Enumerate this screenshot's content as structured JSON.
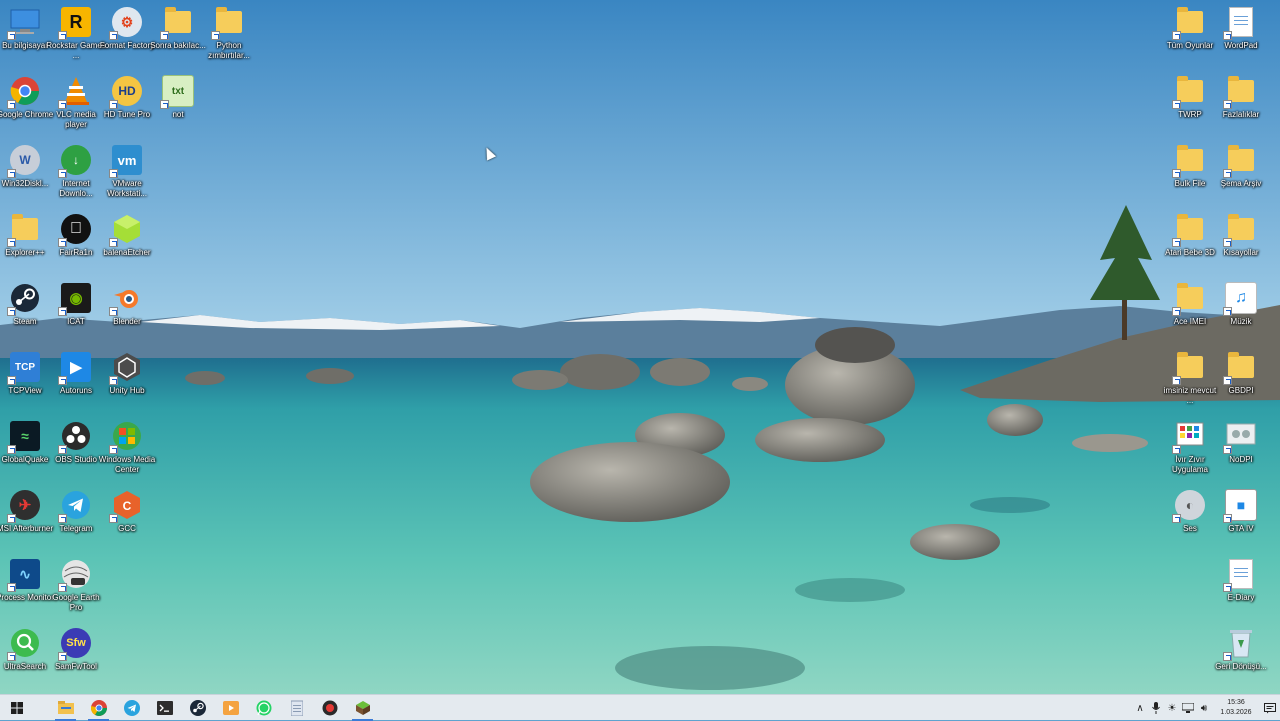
{
  "desktop": {
    "left_icons": [
      {
        "label": "Bu bilgisayar",
        "icon": "this-pc-icon"
      },
      {
        "label": "Rockstar Games ...",
        "icon": "rockstar-icon"
      },
      {
        "label": "Format Factory",
        "icon": "format-factory-icon"
      },
      {
        "label": "Sonra bakılac...",
        "icon": "folder-icon"
      },
      {
        "label": "Python zımbırtılar...",
        "icon": "folder-icon"
      },
      {
        "label": "Google Chrome",
        "icon": "chrome-icon"
      },
      {
        "label": "VLC media player",
        "icon": "vlc-icon"
      },
      {
        "label": "HD Tune Pro",
        "icon": "hdtune-icon"
      },
      {
        "label": "not",
        "icon": "notepad-icon"
      },
      {
        "label": "Win32Diskl...",
        "icon": "win32disk-icon"
      },
      {
        "label": "Internet Downlo...",
        "icon": "idm-icon"
      },
      {
        "label": "VMware Workstati...",
        "icon": "vmware-icon"
      },
      {
        "label": "Explorer++",
        "icon": "folder-icon"
      },
      {
        "label": "FairRa1n",
        "icon": "apple-icon"
      },
      {
        "label": "balenaEtcher",
        "icon": "etcher-icon"
      },
      {
        "label": "Steam",
        "icon": "steam-icon"
      },
      {
        "label": "ICAT",
        "icon": "nvidia-icon"
      },
      {
        "label": "Blender",
        "icon": "blender-icon"
      },
      {
        "label": "TCPView",
        "icon": "tcpview-icon"
      },
      {
        "label": "Autoruns",
        "icon": "autoruns-icon"
      },
      {
        "label": "Unity Hub",
        "icon": "unity-icon"
      },
      {
        "label": "GlobalQuake",
        "icon": "globalquake-icon"
      },
      {
        "label": "OBS Studio",
        "icon": "obs-icon"
      },
      {
        "label": "Windows Media Center",
        "icon": "wmc-icon"
      },
      {
        "label": "MSI Afterburner",
        "icon": "afterburner-icon"
      },
      {
        "label": "Telegram",
        "icon": "telegram-icon"
      },
      {
        "label": "GCC",
        "icon": "gcc-icon"
      },
      {
        "label": "Process Monitor",
        "icon": "procmon-icon"
      },
      {
        "label": "Google Earth Pro",
        "icon": "earth-icon"
      },
      {
        "label": "UltraSearch",
        "icon": "ultrasearch-icon"
      },
      {
        "label": "SamFwTool",
        "icon": "samfw-icon"
      }
    ],
    "right_icons": [
      {
        "label": "Tüm Oyunlar",
        "icon": "folder-icon"
      },
      {
        "label": "WordPad",
        "icon": "wordpad-icon"
      },
      {
        "label": "TWRP",
        "icon": "folder-icon"
      },
      {
        "label": "Fazlalıklar",
        "icon": "folder-icon"
      },
      {
        "label": "Bulk File",
        "icon": "folder-icon"
      },
      {
        "label": "Şema Arşiv",
        "icon": "folder-icon"
      },
      {
        "label": "Atari Bebe 3D",
        "icon": "folder-icon"
      },
      {
        "label": "Kısayollar",
        "icon": "folder-icon"
      },
      {
        "label": "Ace IMEI",
        "icon": "folder-icon"
      },
      {
        "label": "Müzik",
        "icon": "music-icon"
      },
      {
        "label": "imsiniz mevcut ...",
        "icon": "folder-icon"
      },
      {
        "label": "GBDPI",
        "icon": "folder-icon"
      },
      {
        "label": "İvır Zıvır Uygulama",
        "icon": "apps-grid-icon"
      },
      {
        "label": "NoDPI",
        "icon": "nodpi-icon"
      },
      {
        "label": "Ses",
        "icon": "speaker-icon"
      },
      {
        "label": "GTA IV",
        "icon": "gta-icon"
      },
      {
        "label": "E-Diary",
        "icon": "document-icon"
      },
      {
        "label": "Geri Dönüşü...",
        "icon": "recycle-bin-icon"
      }
    ]
  },
  "taskbar": {
    "apps": [
      "start-icon",
      "file-explorer-icon",
      "chrome-icon",
      "telegram-icon",
      "terminal-icon",
      "steam-icon",
      "media-player-icon",
      "whatsapp-icon",
      "notepad-icon",
      "record-icon",
      "minecraft-icon"
    ],
    "active_app": "minecraft-icon",
    "tray": {
      "time": "15:36",
      "date": "1.03.2026"
    }
  },
  "colors": {
    "taskbar_bg": "#e4eaef",
    "accent": "#3b7bd6",
    "sky_top": "#3d8ac4",
    "water": "#3fb3b0"
  }
}
